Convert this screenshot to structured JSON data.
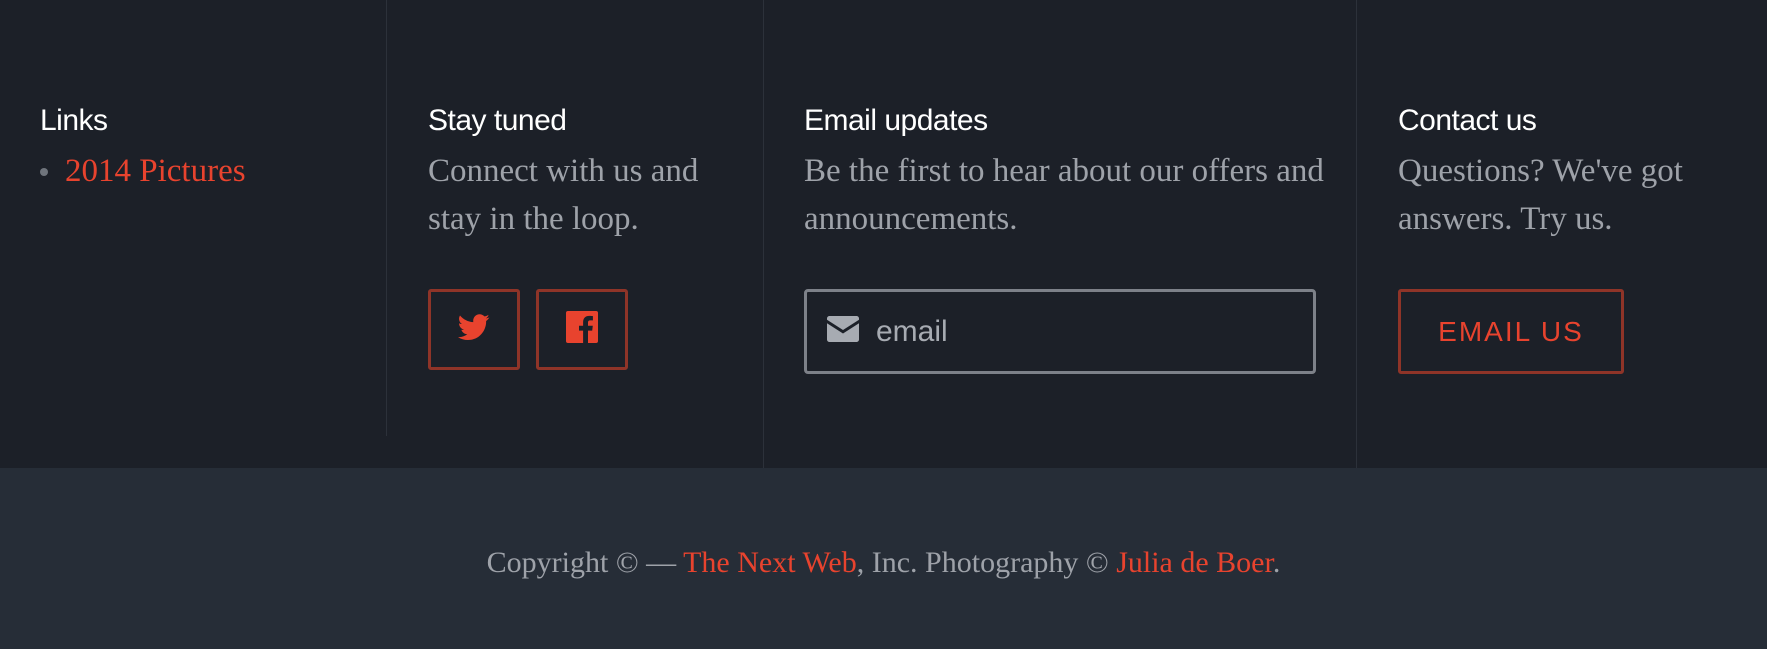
{
  "links": {
    "heading": "Links",
    "items": [
      {
        "label": "2014 Pictures"
      }
    ]
  },
  "stay_tuned": {
    "heading": "Stay tuned",
    "text": "Connect with us and stay in the loop.",
    "social": [
      {
        "icon": "twitter-icon"
      },
      {
        "icon": "facebook-icon"
      }
    ]
  },
  "email_updates": {
    "heading": "Email updates",
    "text": "Be the first to hear about our offers and announcements.",
    "field": {
      "icon": "envelope-icon",
      "placeholder": "email",
      "value": ""
    }
  },
  "contact": {
    "heading": "Contact us",
    "text": "Questions? We've got answers. Try us.",
    "button_label": "EMAIL US"
  },
  "copyright": {
    "prefix": "Copyright © — ",
    "link1": "The Next Web",
    "middle": ", Inc. Photography © ",
    "link2": "Julia de Boer",
    "suffix": "."
  },
  "colors": {
    "accent": "#e8432e",
    "accent_border": "#8f3428",
    "background_top": "#1c2028",
    "background_bottom": "#262d37",
    "muted_text": "#9ea2a9"
  }
}
